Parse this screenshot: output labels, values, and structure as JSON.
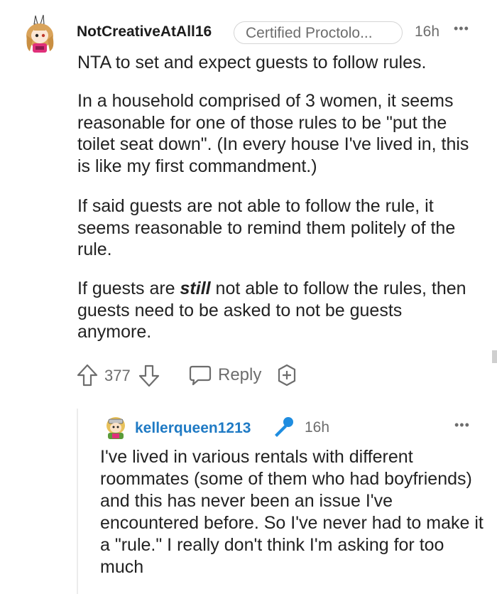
{
  "comment": {
    "username": "NotCreativeAtAll16",
    "flair": "Certified Proctolo...",
    "time": "16h",
    "more": "•••",
    "paragraphs": {
      "p1": "NTA to set and expect guests to follow rules.",
      "p2": "In a household comprised of 3 women, it seems reasonable for one of those rules to be \"put the toilet seat down\". (In every house I've lived in, this is like my first commandment.)",
      "p3": "If said guests are not able to follow the rule, it seems reasonable to remind them politely of the rule.",
      "p4_before": "If guests are ",
      "p4_emph": "still",
      "p4_after": " not able to follow the rules, then guests need to be asked to not be guests anymore."
    },
    "votes": "377",
    "reply_label": "Reply"
  },
  "reply": {
    "username": "kellerqueen1213",
    "time": "16h",
    "more": "•••",
    "text": "I've lived in various rentals with different roommates (some of them who had boyfriends) and this has never been an issue I've encountered before. So I've never had to make it a \"rule.\" I really don't think I'm asking for too much"
  },
  "colors": {
    "username_reply": "#1f7ac4",
    "meta_gray": "#6d6d6d",
    "mic": "#1f8de0"
  },
  "icons": [
    "avatar-bunny",
    "upvote-icon",
    "downvote-icon",
    "reply-icon",
    "award-icon",
    "microphone-icon",
    "avatar-knight",
    "more-icon"
  ]
}
